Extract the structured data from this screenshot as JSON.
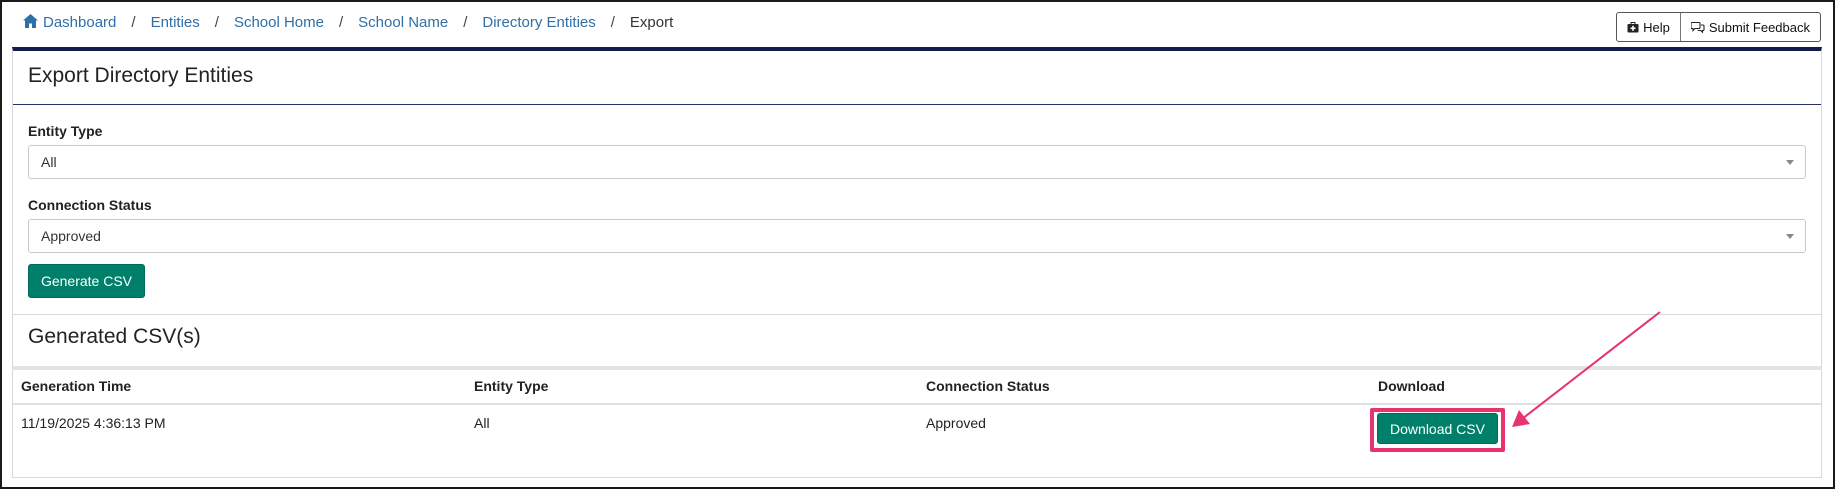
{
  "breadcrumb": {
    "items": [
      "Dashboard",
      "Entities",
      "School Home",
      "School Name",
      "Directory Entities"
    ],
    "current": "Export",
    "separator": "/"
  },
  "header_actions": {
    "help_label": "Help",
    "feedback_label": "Submit Feedback"
  },
  "export_card": {
    "title": "Export Directory Entities",
    "entity_type_label": "Entity Type",
    "entity_type_value": "All",
    "connection_status_label": "Connection Status",
    "connection_status_value": "Approved",
    "generate_label": "Generate CSV"
  },
  "generated": {
    "title": "Generated CSV(s)",
    "columns": [
      "Generation Time",
      "Entity Type",
      "Connection Status",
      "Download"
    ],
    "rows": [
      {
        "generation_time": "11/19/2025 4:36:13 PM",
        "entity_type": "All",
        "connection_status": "Approved",
        "download_label": "Download CSV"
      }
    ]
  },
  "colors": {
    "primary_green": "#00806a",
    "link_blue": "#2f6fa8",
    "header_navy": "#141d4a",
    "annotation_pink": "#e8336d"
  },
  "icons": {
    "home": "home-icon",
    "help": "first-aid-kit-icon",
    "feedback": "chat-bubbles-icon",
    "caret": "caret-down-icon"
  }
}
